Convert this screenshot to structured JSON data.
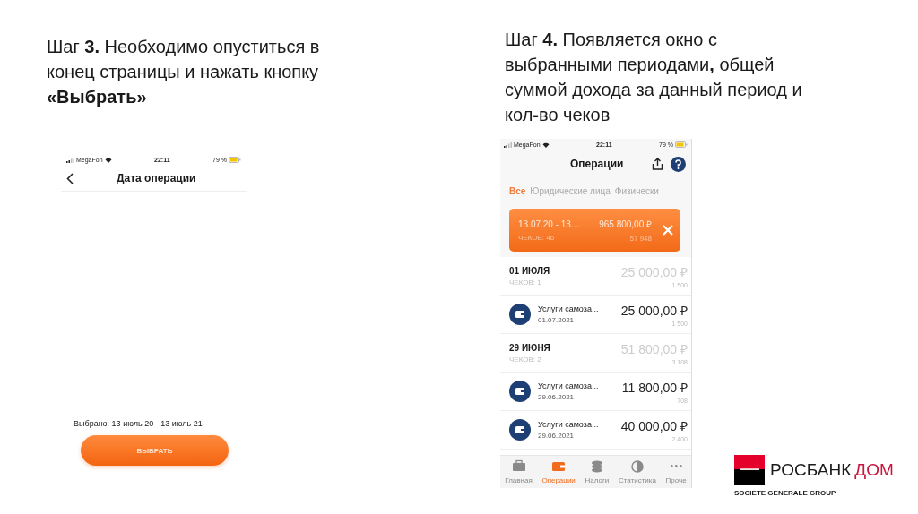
{
  "steps": [
    {
      "text": "Шаг **3.** Необходимо опуститься в конец страницы и нажать кнопку **«Выбрать»**"
    },
    {
      "text": "Шаг **4.** Появляется окно с выбранными периодами**,** общей суммой дохода за данный период и кол**-**во чеков"
    }
  ],
  "date_screen": {
    "status_bar": {
      "carrier": "MegaFon",
      "time": "22:11",
      "battery": "79 %"
    },
    "title": "Дата операции",
    "selected_text": "Выбрано: 13 июль 20 - 13 июль 21",
    "button": "ВЫБРАТЬ"
  },
  "operations_screen": {
    "status_bar": {
      "carrier": "MegaFon",
      "time": "22:11",
      "battery": "79 %"
    },
    "title": "Операции",
    "tabs": [
      {
        "label": "Все",
        "selected": true
      },
      {
        "label": "Юридические лица",
        "selected": false
      },
      {
        "label": "Физически",
        "selected": false
      }
    ],
    "summary": {
      "period": "13.07.20 - 13....",
      "amount": "965 800,00 ₽",
      "checks": "ЧЕКОВ: 46",
      "tax": "57 948"
    },
    "rows": [
      {
        "kind": "day",
        "title": "01 ИЮЛЯ",
        "subtitle": "ЧЕКОВ: 1",
        "amount": "25 000,00 ₽",
        "tax": "1 500"
      },
      {
        "kind": "operation",
        "title": "Услуги самоза...",
        "subtitle": "01.07.2021",
        "amount": "25 000,00 ₽",
        "tax": "1 500"
      },
      {
        "kind": "day",
        "title": "29 ИЮНЯ",
        "subtitle": "ЧЕКОВ: 2",
        "amount": "51 800,00 ₽",
        "tax": "3 108"
      },
      {
        "kind": "operation",
        "title": "Услуги самоза...",
        "subtitle": "29.06.2021",
        "amount": "11 800,00 ₽",
        "tax": "708"
      },
      {
        "kind": "operation",
        "title": "Услуги самоза...",
        "subtitle": "29.06.2021",
        "amount": "40 000,00 ₽",
        "tax": "2 400"
      }
    ],
    "nav": [
      {
        "kind": "home",
        "label": "Главная",
        "selected": false
      },
      {
        "kind": "operations",
        "label": "Операции",
        "selected": true
      },
      {
        "kind": "taxes",
        "label": "Налоги",
        "selected": false
      },
      {
        "kind": "stats",
        "label": "Статистика",
        "selected": false
      },
      {
        "kind": "more",
        "label": "Проче",
        "selected": false
      }
    ]
  },
  "logo": {
    "brand": "РОСБАНК",
    "suffix": "ДОМ",
    "group": "SOCIETE GENERALE GROUP"
  }
}
